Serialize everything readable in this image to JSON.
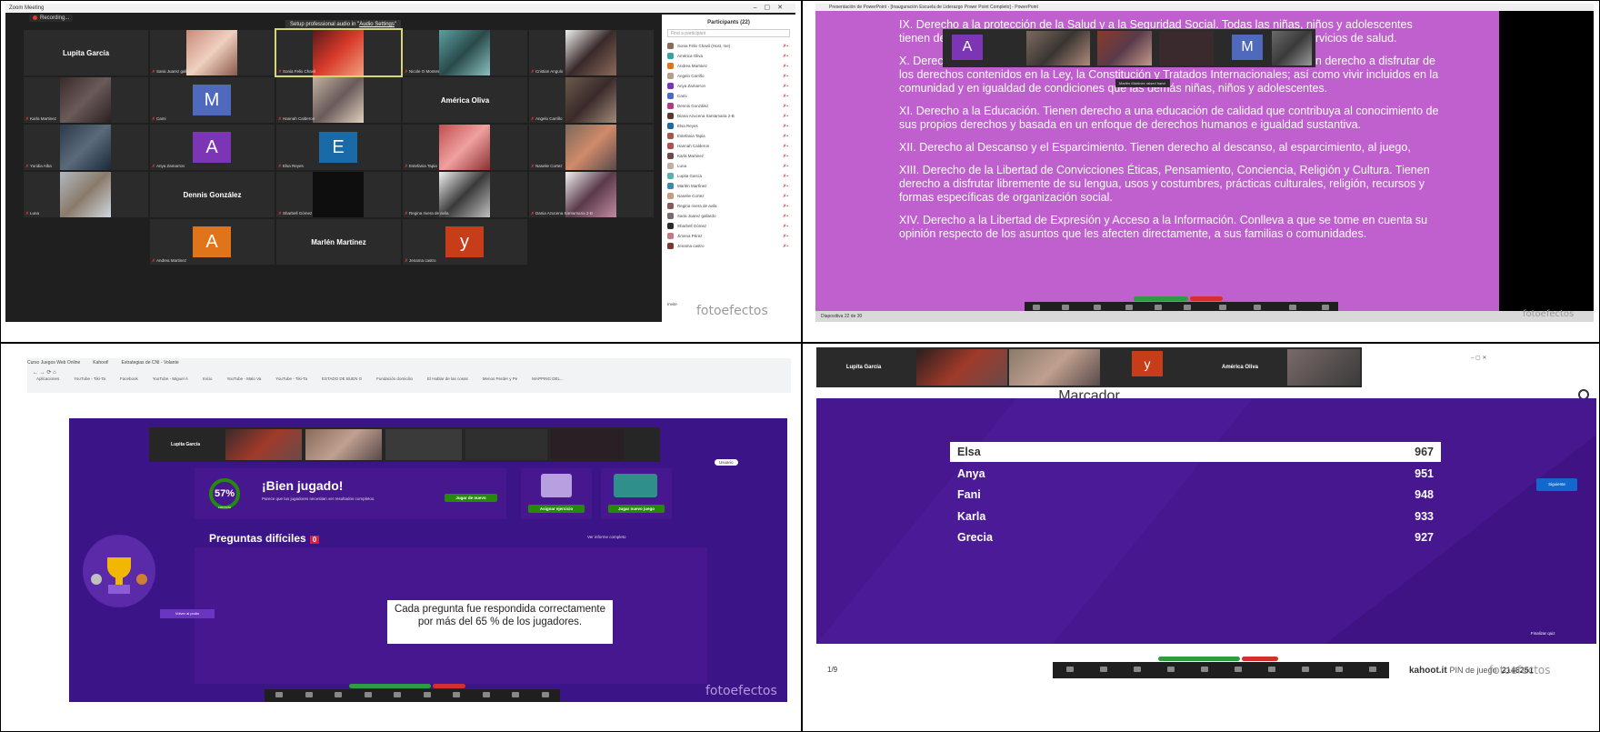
{
  "colors": {
    "zoom_dark": "#1f1f1f",
    "slide_purple": "#c060cf",
    "kahoot_purple": "#46178f",
    "kahoot_dark": "#3b1588",
    "green": "#26890c",
    "red": "#e21b3c"
  },
  "watermark": "fotoefectos",
  "p1": {
    "window_title": "Zoom Meeting",
    "recording": "Recording...",
    "audio_banner_prefix": "Setup professional audio in",
    "audio_banner_link": "Audio Settings",
    "participants_title": "Participants (22)",
    "search_placeholder": "Find a participant",
    "tiles": [
      {
        "name_big": "Lupita García",
        "cap": ""
      },
      {
        "name_big": "",
        "cap": "Sarai Juarez gallardo"
      },
      {
        "name_big": "",
        "cap": "Sonia Felix Chavil"
      },
      {
        "name_big": "",
        "cap": "Nicole O Montes"
      },
      {
        "name_big": "",
        "cap": "Cristian Angulo"
      },
      {
        "name_big": "",
        "cap": "Karla Martinez"
      },
      {
        "name_big": "",
        "cap": "Cami",
        "avatar": "M"
      },
      {
        "name_big": "",
        "cap": "Hannah Calderon"
      },
      {
        "name_big": "América Oliva",
        "cap": ""
      },
      {
        "name_big": "",
        "cap": "Angelo Carrillo"
      },
      {
        "name_big": "",
        "cap": "Yuridia Alba"
      },
      {
        "name_big": "",
        "cap": "Anya Zamarron",
        "avatar": "A"
      },
      {
        "name_big": "",
        "cap": "Elsa Reyes",
        "avatar": "E"
      },
      {
        "name_big": "",
        "cap": "Estefania Tapia"
      },
      {
        "name_big": "",
        "cap": "Naselie Cortez"
      },
      {
        "name_big": "",
        "cap": "Luna"
      },
      {
        "name_big": "Dennis González",
        "cap": ""
      },
      {
        "name_big": "",
        "cap": "Sharbell Gómez"
      },
      {
        "name_big": "",
        "cap": "Regina rivera de avila"
      },
      {
        "name_big": "",
        "cap": "Dania Azucena Santamaria 2-B"
      },
      {
        "name_big": "",
        "cap": "Andrea Martinez",
        "avatar": "A"
      },
      {
        "name_big": "Marlén Martínez",
        "cap": ""
      },
      {
        "name_big": "",
        "cap": "Jenama castro",
        "avatar": "y"
      }
    ],
    "participants": [
      "Sonia Felix Chavil (Host, me)",
      "América Oliva",
      "Andrea Martinez",
      "Angelo Carrillo",
      "Anya Zamarron",
      "Cami",
      "Dennis González",
      "Diana Azucena Santamaria 2-B",
      "Elsa Reyes",
      "Estefania Tapia",
      "Hannah Calderon",
      "Karla Martinez",
      "Luna",
      "Lupita García",
      "Marlén Martínez",
      "Naselie Cortez",
      "Regina rivera de avila",
      "Sarai Juarez gallardo",
      "Sharbell Gómez",
      "Jimena Pérez",
      "Jenama castro"
    ],
    "invite": "Invite"
  },
  "p2": {
    "title": "Presentación de PowerPoint - [Inauguración Escuela de Liderazgo Power Point Completo] - PowerPoint",
    "paragraphs": [
      "IX. Derecho a la protección de la Salud y a la Seguridad Social. Todas las niñas, niños y adolescentes tienen derecho a disfrutar del más alto nivel posible de salud, así como a recibir servicios de salud.",
      "X. Derecho a la Inclusión de Niñas, Niños y Adolescentes con Discapacidad. Tienen derecho a disfrutar de los derechos contenidos en la Ley, la Constitución y Tratados Internacionales; así como vivir incluidos en la comunidad y en igualdad de condiciones que las demás niñas, niños y adolescentes.",
      "XI. Derecho a la Educación. Tienen derecho a una educación de calidad que contribuya al conocimiento de sus propios derechos y basada en un enfoque de derechos humanos e igualdad sustantiva.",
      "XII. Derecho al Descanso y el Esparcimiento. Tienen derecho al descanso, al esparcimiento, al juego,",
      "XIII. Derecho de la Libertad de Convicciones Éticas, Pensamiento, Conciencia, Religión y Cultura. Tienen derecho a disfrutar libremente de su lengua, usos y costumbres, prácticas culturales, religión, recursos y formas específicas de organización social.",
      "XIV. Derecho a la Libertad de Expresión y Acceso a la Información. Conlleva a que se tome en cuenta su opinión respecto de los asuntos que les afecten directamente, a sus familias o comunidades."
    ],
    "status": "Diapositiva 22 de 30",
    "tip": "Marlén Martinez raised hand",
    "strip_avatars": [
      "A",
      "M"
    ],
    "toolbar": [
      "Mute",
      "Stop Video",
      "Security",
      "Participants",
      "Chat",
      "New Share",
      "Pause Share",
      "Annotate",
      "Remote Control",
      "More"
    ]
  },
  "p3": {
    "tabs": [
      "Curso Juegos Web Online",
      "Kahoot!",
      "Estrategias de CNI - Volante"
    ],
    "bookmarks": [
      "Aplicaciones",
      "YouTube - Tiki-Ta",
      "Facebook",
      "YouTube - Miguel Á",
      "Inicio",
      "YouTube - Malo Va",
      "YouTube - Tiki-Ta",
      "ESTADO DE BUEN G",
      "Fundación domicilio",
      "El Hablar de las cosas",
      "Menos Perder y Pe",
      "MAPPING DEL..."
    ],
    "bien_jugado": "¡Bien jugado!",
    "percent": "57",
    "percent_label": "correcto",
    "sub": "Parece que tus jugadores necesitan ver resultados completos.",
    "jugar_button": "Jugar de nuevo",
    "card2_button": "Asignar ejercicio",
    "card3_button": "Jugar nuevo juego",
    "preguntas": "Preguntas difíciles",
    "count": "0",
    "ver_link": "Ver informe completo",
    "message": "Cada pregunta fue respondida correctamente por más del 65 % de los jugadores.",
    "see_podium": "Volver al podio",
    "user": "Usuario"
  },
  "p4": {
    "strip": [
      "Lupita García",
      "y",
      "América Oliva"
    ],
    "title": "Marcador",
    "next": "Siguiente",
    "counter": "1/9",
    "finish": "Finalizar quiz",
    "kahoot_label": "kahoot.it",
    "pin_label": "PIN de juego:",
    "pin": "2146251",
    "scores": [
      {
        "name": "Elsa",
        "score": "967"
      },
      {
        "name": "Anya",
        "score": "951"
      },
      {
        "name": "Fani",
        "score": "948"
      },
      {
        "name": "Karla",
        "score": "933"
      },
      {
        "name": "Grecia",
        "score": "927"
      }
    ]
  }
}
